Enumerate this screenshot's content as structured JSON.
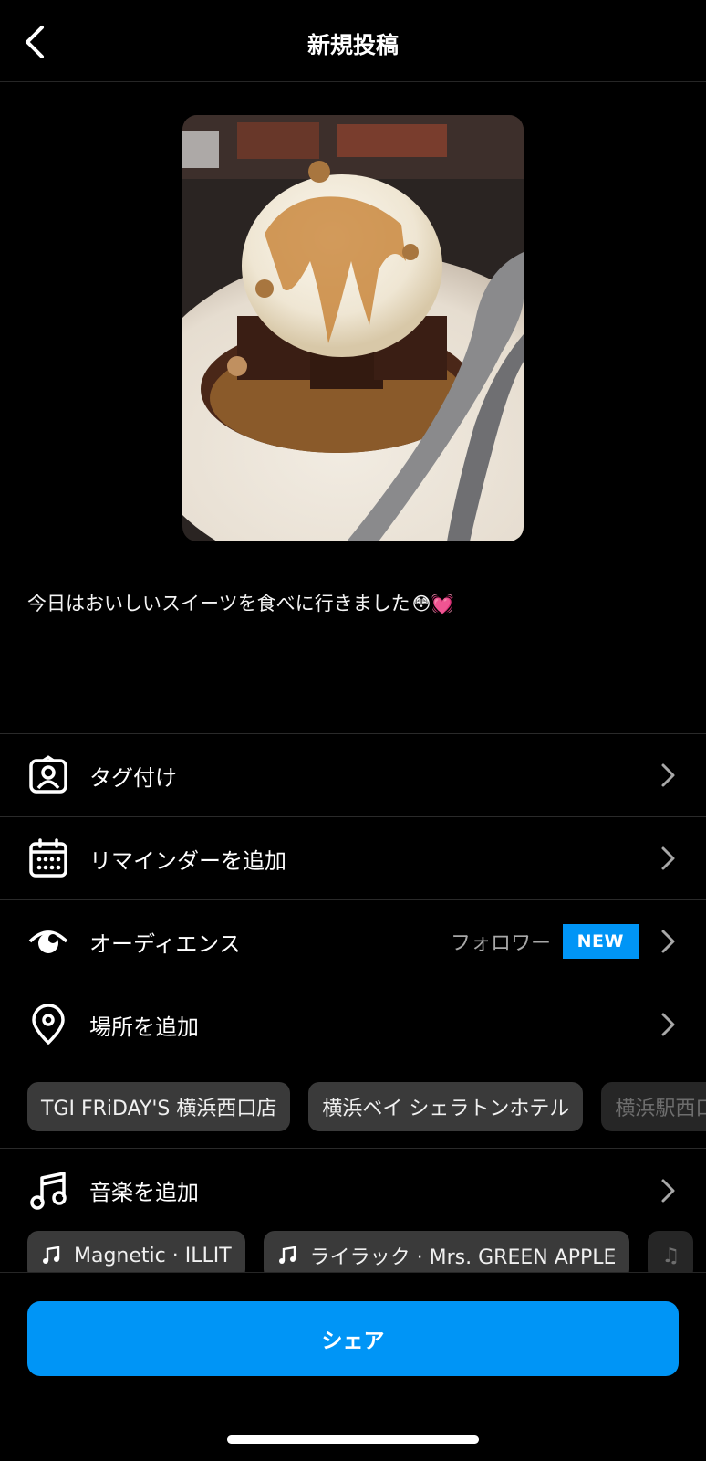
{
  "header": {
    "title": "新規投稿"
  },
  "caption": {
    "text": "今日はおいしいスイーツを食べに行きました",
    "emoji": "😳💓"
  },
  "rows": {
    "tag": {
      "label": "タグ付け"
    },
    "reminder": {
      "label": "リマインダーを追加"
    },
    "audience": {
      "label": "オーディエンス",
      "value": "フォロワー",
      "badge": "NEW"
    },
    "location": {
      "label": "場所を追加"
    },
    "music": {
      "label": "音楽を追加"
    }
  },
  "location_suggestions": [
    "TGI FRiDAY'S 横浜西口店",
    "横浜ベイ シェラトンホテル",
    "横浜駅西口"
  ],
  "music_suggestions": [
    "Magnetic · ILLIT",
    "ライラック · Mrs. GREEN APPLE",
    "♫"
  ],
  "share_button": {
    "label": "シェア"
  },
  "colors": {
    "accent": "#0095f6",
    "background": "#000000",
    "chip": "#3a3a3a"
  }
}
